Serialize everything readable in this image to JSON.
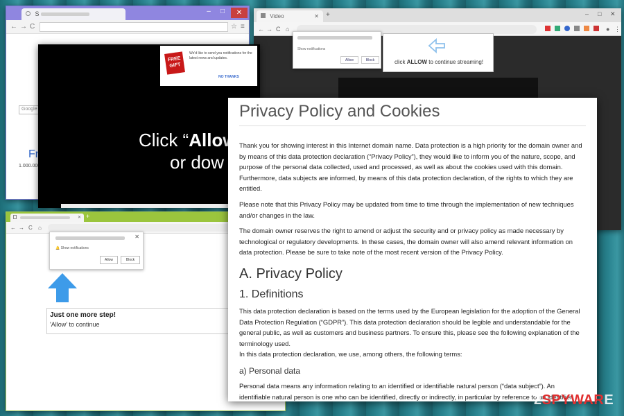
{
  "colors": {
    "background_teal": "#2a8490",
    "window1_tabbar": "#8f86e0",
    "window4_tabbar": "#9bc53d",
    "arrow_blue": "#3d9be9",
    "gift_red": "#c81818",
    "watermark_red": "#e03030"
  },
  "window1": {
    "tab_title": "S",
    "search_hint": "Google",
    "headline_fragment": "Fr",
    "count_fragment": "1.000.000"
  },
  "window2": {
    "tab_title": "Video",
    "notification_label": "Show notifications",
    "allow_button": "Allow",
    "block_button": "Block",
    "prompt_prefix": "click ",
    "prompt_emphasis": "ALLOW",
    "prompt_suffix": " to continue streaming!"
  },
  "window3": {
    "headline_prefix": "Click “",
    "headline_emphasis": "Allow",
    "headline_line2": "or dow",
    "gift_badge": "FREE GIFT",
    "gift_message": "We'd like to send you notifications for the latest news and updates.",
    "no_thanks": "NO THANKS"
  },
  "window4": {
    "notification_label": "Show notifications",
    "allow_button": "Allow",
    "block_button": "Block",
    "step_title": "Just one more step!",
    "step_subtitle": "'Allow' to continue"
  },
  "privacy_doc": {
    "title": "Privacy Policy and Cookies",
    "intro": "Thank you for showing interest in this Internet domain name. Data protection is a high priority for the domain owner and by means of this data protection declaration (“Privacy Policy”), they would like to inform you of the nature, scope, and purpose of the personal data collected, used and processed, as well as about the cookies used with this domain. Furthermore, data subjects are informed, by means of this data protection declaration, of the rights to which they are entitled.",
    "update_note": "Please note that this Privacy Policy may be updated from time to time through the implementation of new techniques and/or changes in the law.",
    "amend_note": "The domain owner reserves the right to amend or adjust the security and or privacy policy as made necessary by technological or regulatory developments. In these cases, the domain owner will also amend relevant information on data protection. Please be sure to take note of the most recent version of the Privacy Policy.",
    "section_a": "A. Privacy Policy",
    "section_1": "1. Definitions",
    "definitions_text": "This data protection declaration is based on the terms used by the European legislation for the adoption of the General Data Protection Regulation (“GDPR”). This data protection declaration should be legible and understandable for the general public, as well as customers and business partners. To ensure this, please see the following explanation of the terminology used.",
    "definitions_text2": "In this data protection declaration, we use, among others, the following terms:",
    "section_a_sub": "a) Personal data",
    "personal_data_text": "Personal data means any information relating to an identified or identifiable natural person (“data subject”). An identifiable natural person is one who can be identified, directly or indirectly, in particular by reference to an identifier such as a name, an identification number, location data, an online identifier or to one or more factors specific to the"
  },
  "watermark": {
    "prefix": "2",
    "highlight": "SPYWAR",
    "suffix": "E"
  }
}
